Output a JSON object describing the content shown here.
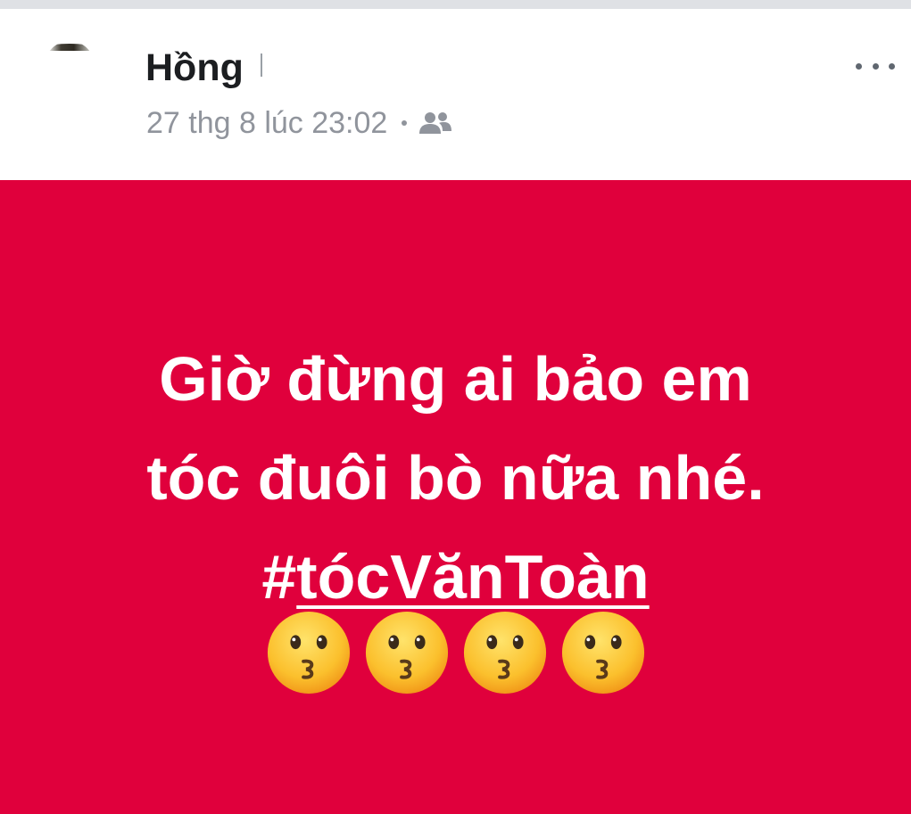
{
  "post": {
    "author_name": "Hồng",
    "timestamp": "27 thg 8 lúc 23:02",
    "separator": "•",
    "audience_icon": "friends-icon",
    "more_icon": "more-options-icon",
    "background_color": "#e0003c",
    "text_line_1": "Giờ đừng ai bảo em",
    "text_line_2": "tóc đuôi bò nữa nhé.",
    "hashtag_symbol": "#",
    "hashtag_text": "tócVănToàn",
    "emojis": [
      "kissing-face-emoji",
      "kissing-face-emoji",
      "kissing-face-emoji",
      "kissing-face-emoji"
    ]
  }
}
